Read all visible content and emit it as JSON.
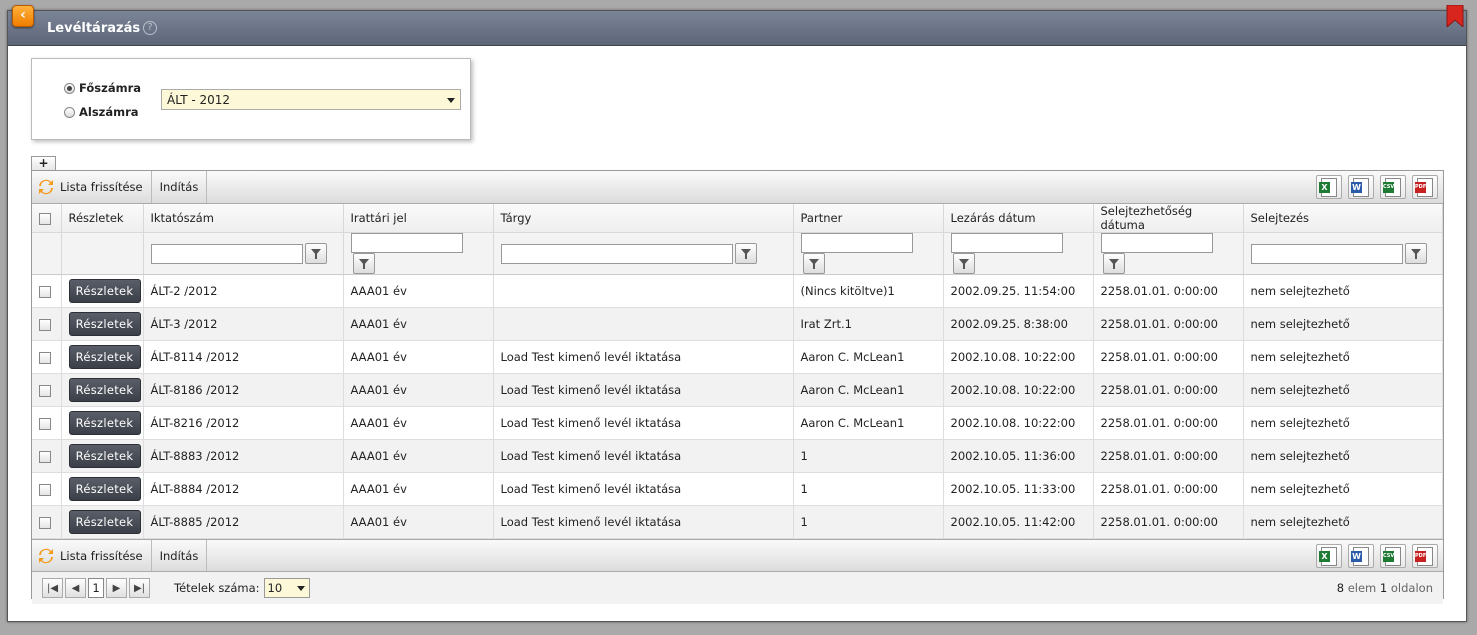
{
  "window": {
    "title": "Levéltárazás",
    "back_icon": "chevron-left-icon",
    "help_glyph": "?"
  },
  "filter": {
    "radio_main": "Főszámra",
    "radio_sub": "Alszámra",
    "selected_radio": "Főszámra",
    "select_value": "ÁLT - 2012"
  },
  "plus_label": "+",
  "toolbar": {
    "refresh_label": "Lista frissítése",
    "start_label": "Indítás",
    "exports": [
      {
        "name": "excel-export-icon",
        "tag": "X",
        "color": "#1e7b34"
      },
      {
        "name": "word-export-icon",
        "tag": "W",
        "color": "#2a5aa8"
      },
      {
        "name": "csv-export-icon",
        "tag": "CSV",
        "color": "#1e7b34"
      },
      {
        "name": "pdf-export-icon",
        "tag": "PDF",
        "color": "#c8201f"
      }
    ]
  },
  "columns": [
    "Részletek",
    "Iktatószám",
    "Irattári jel",
    "Tárgy",
    "Partner",
    "Lezárás dátum",
    "Selejtezhetőség dátuma",
    "Selejtezés"
  ],
  "detail_button_label": "Részletek",
  "rows": [
    {
      "iktatoszam": "ÁLT-2 /2012",
      "irattari_jel": "AAA01 év",
      "targy": "",
      "partner": "(Nincs kitöltve)1",
      "lezaras": "2002.09.25. 11:54:00",
      "selejtezhetoseg": "2258.01.01. 0:00:00",
      "selejtezes": "nem selejtezhető"
    },
    {
      "iktatoszam": "ÁLT-3 /2012",
      "irattari_jel": "AAA01 év",
      "targy": "",
      "partner": "Irat Zrt.1",
      "lezaras": "2002.09.25. 8:38:00",
      "selejtezhetoseg": "2258.01.01. 0:00:00",
      "selejtezes": "nem selejtezhető"
    },
    {
      "iktatoszam": "ÁLT-8114 /2012",
      "irattari_jel": "AAA01 év",
      "targy": "Load Test kimenő levél iktatása",
      "partner": "Aaron C. McLean1",
      "lezaras": "2002.10.08. 10:22:00",
      "selejtezhetoseg": "2258.01.01. 0:00:00",
      "selejtezes": "nem selejtezhető"
    },
    {
      "iktatoszam": "ÁLT-8186 /2012",
      "irattari_jel": "AAA01 év",
      "targy": "Load Test kimenő levél iktatása",
      "partner": "Aaron C. McLean1",
      "lezaras": "2002.10.08. 10:22:00",
      "selejtezhetoseg": "2258.01.01. 0:00:00",
      "selejtezes": "nem selejtezhető"
    },
    {
      "iktatoszam": "ÁLT-8216 /2012",
      "irattari_jel": "AAA01 év",
      "targy": "Load Test kimenő levél iktatása",
      "partner": "Aaron C. McLean1",
      "lezaras": "2002.10.08. 10:22:00",
      "selejtezhetoseg": "2258.01.01. 0:00:00",
      "selejtezes": "nem selejtezhető"
    },
    {
      "iktatoszam": "ÁLT-8883 /2012",
      "irattari_jel": "AAA01 év",
      "targy": "Load Test kimenő levél iktatása",
      "partner": "1",
      "lezaras": "2002.10.05. 11:36:00",
      "selejtezhetoseg": "2258.01.01. 0:00:00",
      "selejtezes": "nem selejtezhető"
    },
    {
      "iktatoszam": "ÁLT-8884 /2012",
      "irattari_jel": "AAA01 év",
      "targy": "Load Test kimenő levél iktatása",
      "partner": "1",
      "lezaras": "2002.10.05. 11:33:00",
      "selejtezhetoseg": "2258.01.01. 0:00:00",
      "selejtezes": "nem selejtezhető"
    },
    {
      "iktatoszam": "ÁLT-8885 /2012",
      "irattari_jel": "AAA01 év",
      "targy": "Load Test kimenő levél iktatása",
      "partner": "1",
      "lezaras": "2002.10.05. 11:42:00",
      "selejtezhetoseg": "2258.01.01. 0:00:00",
      "selejtezes": "nem selejtezhető"
    }
  ],
  "pager": {
    "page": "1",
    "page_size_label": "Tételek száma:",
    "page_size": "10",
    "count": "8",
    "elem_label": "elem",
    "pages": "1",
    "oldalon_label": "oldalon"
  }
}
